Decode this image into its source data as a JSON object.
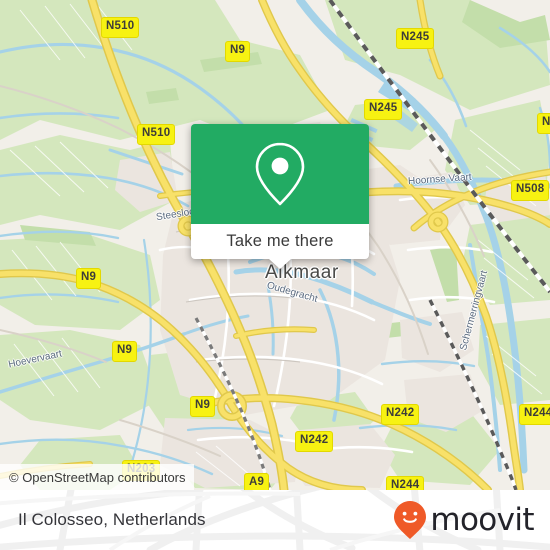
{
  "map": {
    "city_label": "Alkmaar",
    "attribution": "© OpenStreetMap contributors",
    "water_labels": [
      {
        "text": "Steesloot"
      },
      {
        "text": "Oudegracht"
      },
      {
        "text": "Hoornse Vaart"
      },
      {
        "text": "Hoevervaart"
      },
      {
        "text": "Schermerringvaart"
      }
    ],
    "road_shields": [
      {
        "label": "N510"
      },
      {
        "label": "N9"
      },
      {
        "label": "N245"
      },
      {
        "label": "N245"
      },
      {
        "label": "N510"
      },
      {
        "label": "N508"
      },
      {
        "label": "N9"
      },
      {
        "label": "N9"
      },
      {
        "label": "N9"
      },
      {
        "label": "N242"
      },
      {
        "label": "N242"
      },
      {
        "label": "N203"
      },
      {
        "label": "A9"
      },
      {
        "label": "N244"
      },
      {
        "label": "N244"
      }
    ],
    "colors": {
      "land": "#f2efe9",
      "green": "#cfe4b6",
      "urban": "#ece7e1",
      "water": "#9fd0e8",
      "motorway": "#f9dc6d",
      "trunk": "#f5d97a",
      "shield_fill": "#f7f212",
      "shield_border": "#e3d800"
    }
  },
  "callout": {
    "icon": "map-pin-icon",
    "action_label": "Take me there",
    "accent_color": "#22ab63"
  },
  "footer": {
    "place_title": "Il Colosseo, Netherlands",
    "brand_name": "moovit",
    "brand_color": "#ef5a28",
    "brand_text_color": "#23232a"
  }
}
